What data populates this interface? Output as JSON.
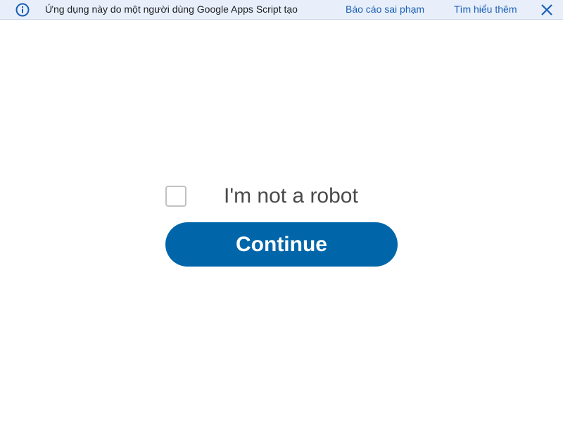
{
  "banner": {
    "icon": "info-icon",
    "message": "Ứng dụng này do một người dùng Google Apps Script tạo",
    "report_link": "Báo cáo sai phạm",
    "learn_more_link": "Tìm hiểu thêm",
    "close_icon": "close-icon",
    "background": "#e8effa",
    "link_color": "#1a5fb4"
  },
  "captcha": {
    "checked": false,
    "label": "I'm not a robot"
  },
  "continue_button": {
    "label": "Continue",
    "color": "#0066a9"
  }
}
